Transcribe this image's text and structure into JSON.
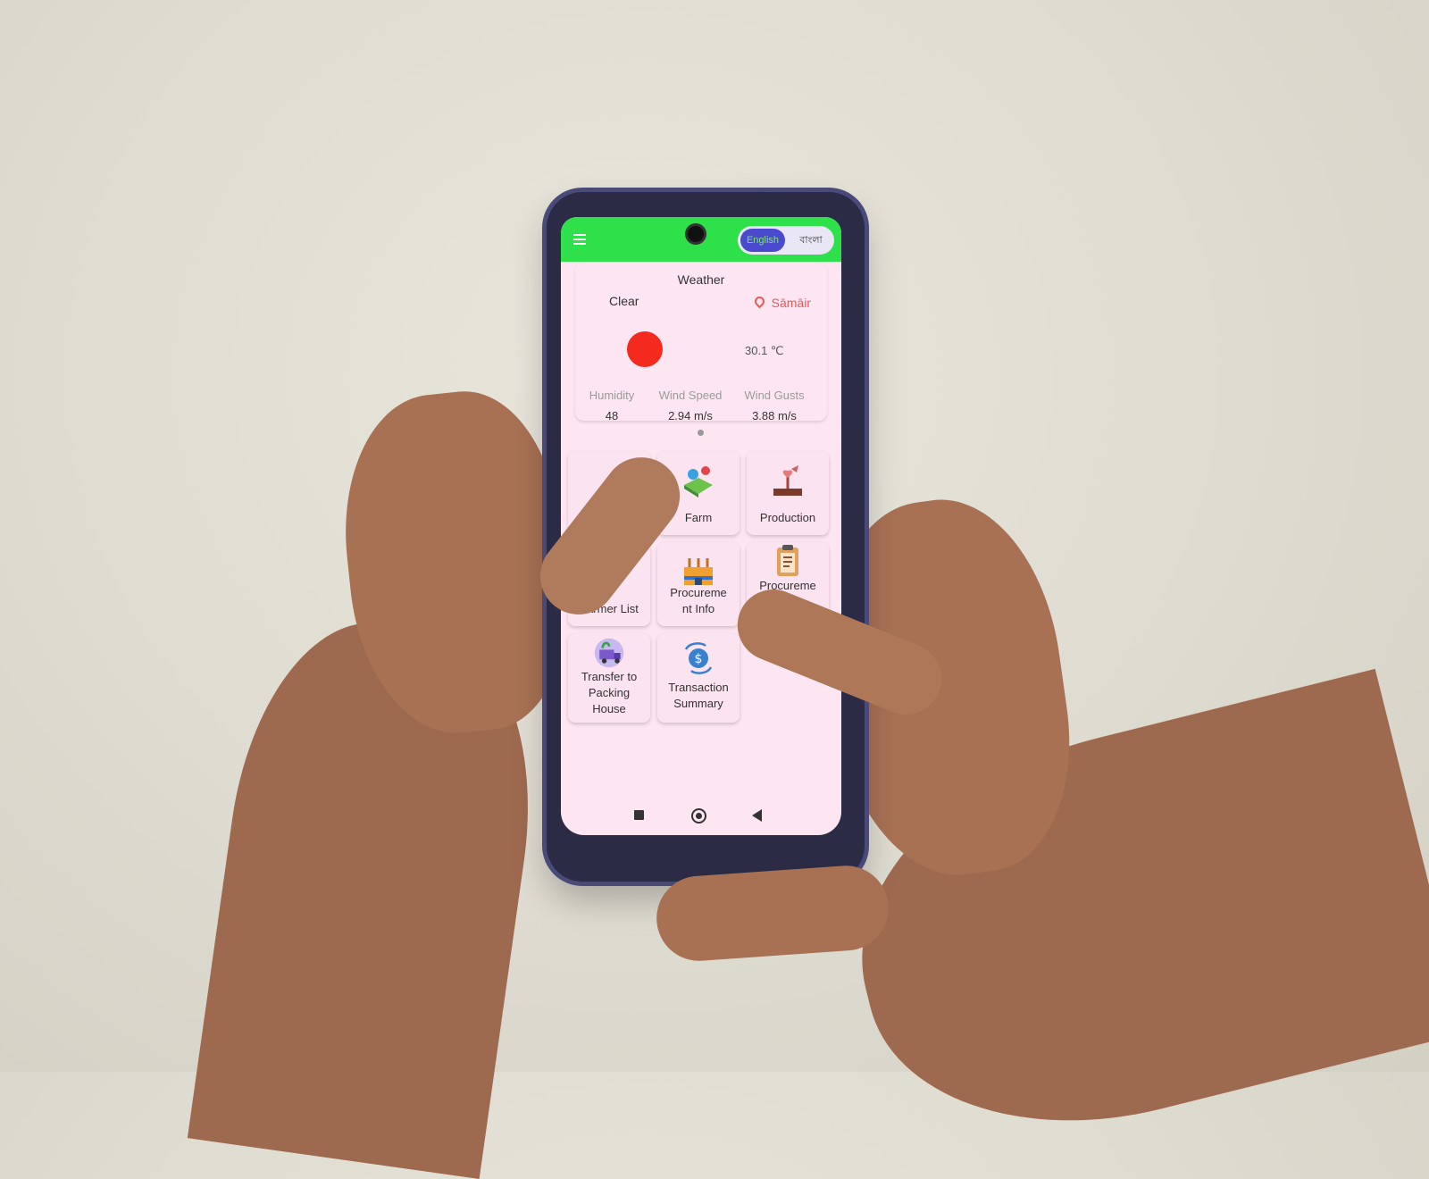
{
  "header": {
    "menu_icon": "hamburger-menu-icon",
    "language_toggle": {
      "selected": "English",
      "other": "বাংলা"
    }
  },
  "weather": {
    "title": "Weather",
    "condition": "Clear",
    "location": "Sāmāir",
    "temperature": "30.1 ℃",
    "icon": "sun-icon",
    "stats": [
      {
        "label": "Humidity",
        "value": "48"
      },
      {
        "label": "Wind Speed",
        "value": "2.94 m/s"
      },
      {
        "label": "Wind Gusts",
        "value": "3.88 m/s"
      }
    ]
  },
  "menu": {
    "tiles": [
      {
        "label": "",
        "icon": "hidden-by-finger"
      },
      {
        "label": "Farm",
        "icon": "farm-map-icon"
      },
      {
        "label": "Production",
        "icon": "production-plant-icon"
      },
      {
        "label": "Farmer List",
        "icon": "farmer-list-icon"
      },
      {
        "label": "Procureme\nnt Info",
        "icon": "procurement-warehouse-icon"
      },
      {
        "label": "Procureme\nnt Info",
        "icon": "procurement-clipboard-icon"
      },
      {
        "label": "Transfer to\nPacking\nHouse",
        "icon": "truck-transfer-icon"
      },
      {
        "label": "Transaction\nSummary",
        "icon": "transaction-exchange-icon"
      }
    ]
  },
  "colors": {
    "appbar": "#2ee04a",
    "screen_bg": "#fde6f2",
    "sun": "#f52a1e",
    "location": "#e65a5a",
    "toggle_active": "#4a4acf"
  },
  "system_nav": [
    "recents-square-icon",
    "home-circle-icon",
    "back-triangle-icon"
  ]
}
